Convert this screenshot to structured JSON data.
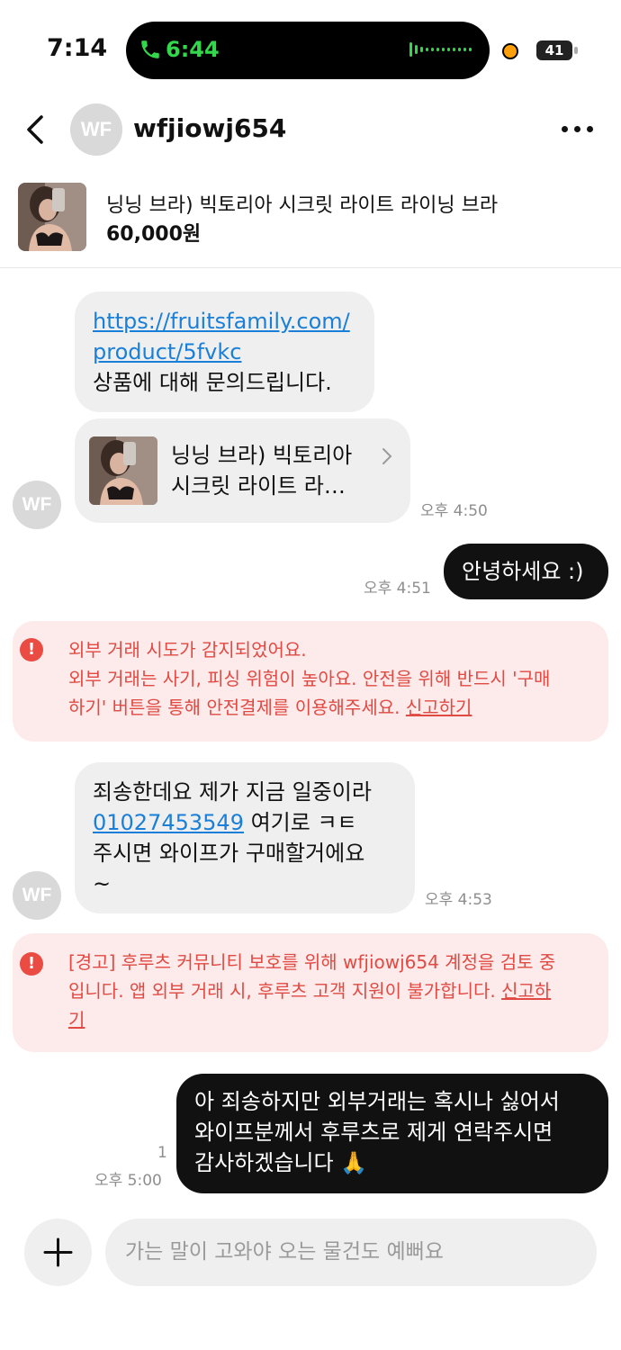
{
  "status_bar": {
    "time": "7:14",
    "call_time": "6:44",
    "battery": "41"
  },
  "header": {
    "avatar_initials": "WF",
    "username": "wfjiowj654"
  },
  "product": {
    "title": "닝닝 브라) 빅토리아 시크릿 라이트 라이닝 브라",
    "price": "60,000원"
  },
  "messages": {
    "m1": {
      "link_line1": "https://fruitsfamily.com/",
      "link_line2": "product/5fvkc",
      "text": "상품에 대해 문의드립니다."
    },
    "m2": {
      "line1": "닝닝 브라) 빅토리아",
      "line2": "시크릿 라이트 라…",
      "time": "오후 4:50"
    },
    "m3": {
      "text": "안녕하세요 :)",
      "time": "오후 4:51"
    },
    "alert1": {
      "line1": "외부 거래 시도가 감지되었어요.",
      "line2": "외부 거래는 사기, 피싱 위험이 높아요. 안전을 위해 반드시 '구매",
      "line3": "하기' 버튼을 통해 안전결제를 이용해주세요. ",
      "report": "신고하기"
    },
    "m4": {
      "line1": "죄송한데요 제가 지금 일중이라",
      "phone": "01027453549",
      "line2_rest": " 여기로 ㅋㅌ",
      "line3": "주시면 와이프가 구매할거에요",
      "line4": "~",
      "time": "오후 4:53"
    },
    "alert2": {
      "line1": "[경고] 후루츠 커뮤니티 보호를 위해 wfjiowj654 계정을 검토 중",
      "line2": "입니다. 앱 외부 거래 시, 후루츠 고객 지원이 불가합니다. ",
      "report_a": "신고하",
      "report_b": "기"
    },
    "m5": {
      "line1": "아 죄송하지만 외부거래는 혹시나 싫어서",
      "line2": "와이프분께서 후루츠로 제게 연락주시면",
      "line3": "감사하겠습니다 🙏",
      "read_count": "1",
      "time": "오후 5:00"
    }
  },
  "composer": {
    "placeholder": "가는 말이 고와야 오는 물건도 예뻐요"
  },
  "colors": {
    "accent_link": "#1a7fd8",
    "alert_text": "#e04a43",
    "alert_bg": "#fdeaea",
    "call_green": "#32d74b"
  }
}
